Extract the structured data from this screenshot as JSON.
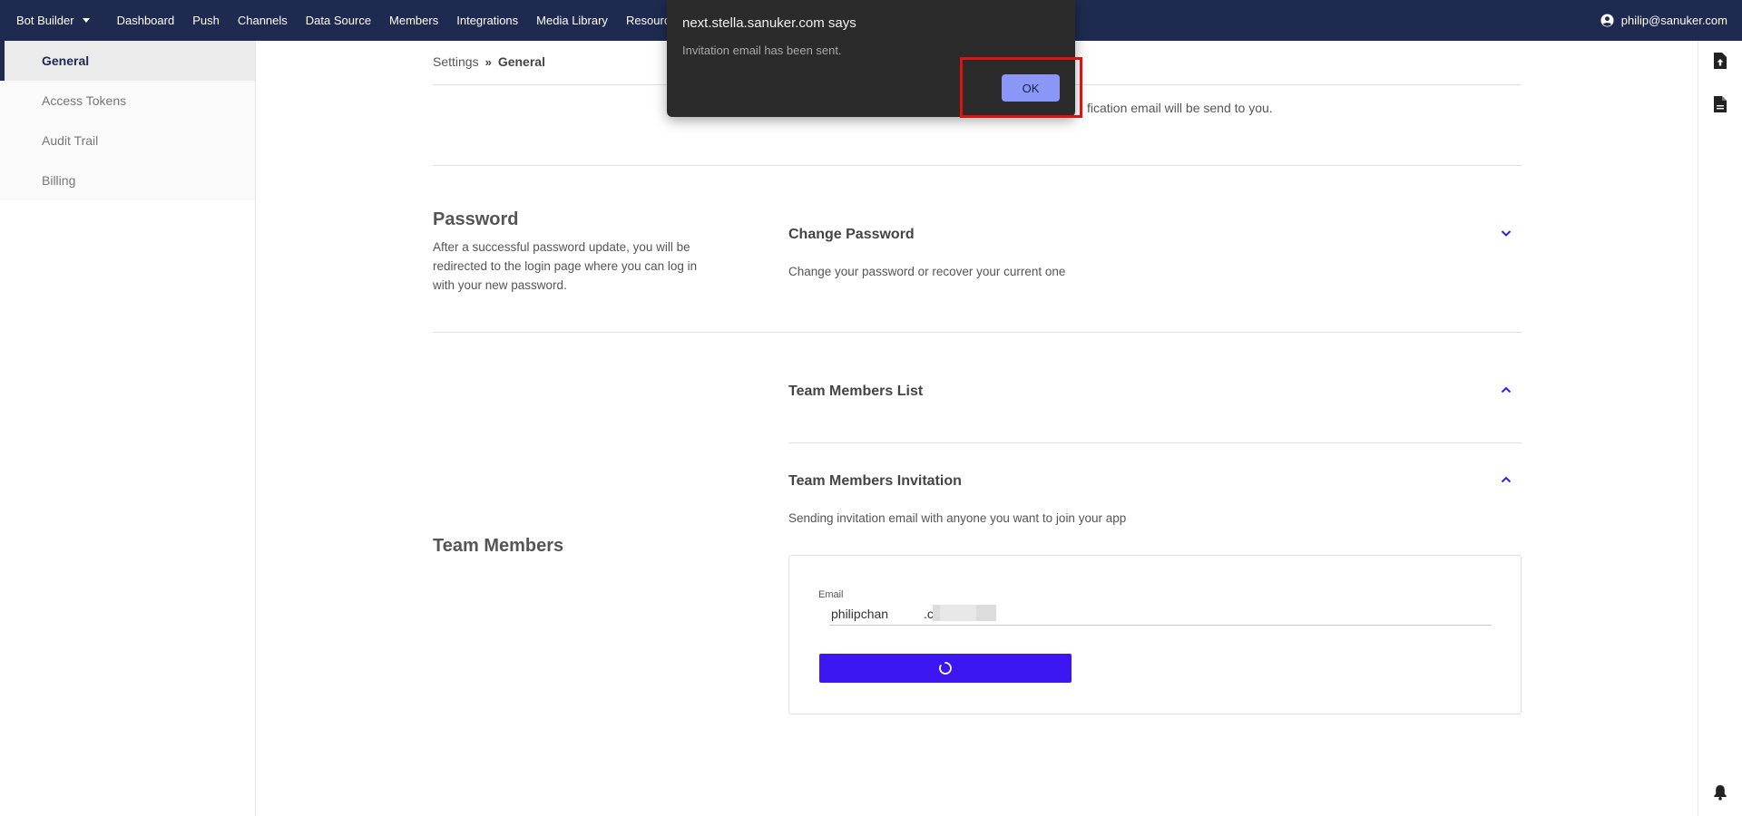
{
  "nav": {
    "brand": "Bot Builder",
    "items": [
      "Dashboard",
      "Push",
      "Channels",
      "Data Source",
      "Members",
      "Integrations",
      "Media Library",
      "Resources"
    ],
    "user_email": "philip@sanuker.com"
  },
  "sidebar": {
    "items": [
      {
        "label": "General",
        "active": true
      },
      {
        "label": "Access Tokens",
        "active": false
      },
      {
        "label": "Audit Trail",
        "active": false
      },
      {
        "label": "Billing",
        "active": false
      }
    ]
  },
  "breadcrumb": {
    "parent": "Settings",
    "separator": "»",
    "current": "General"
  },
  "email_section": {
    "partial_text": "fication email will be send to you."
  },
  "password_section": {
    "title": "Password",
    "description": "After a successful password update, you will be redirected to the login page where you can log in with your new password.",
    "panel_title": "Change Password",
    "panel_description": "Change your password or recover your current one"
  },
  "team_section": {
    "title": "Team Members",
    "list_title": "Team Members List",
    "invite_title": "Team Members Invitation",
    "invite_description": "Sending invitation email with anyone you want to join your app",
    "email_label": "Email",
    "email_value": "philipchan          .com",
    "send_state": "loading"
  },
  "dialog": {
    "title": "next.stella.sanuker.com says",
    "message": "Invitation email has been sent.",
    "ok_label": "OK"
  },
  "colors": {
    "nav_bg": "#1e2a4f",
    "accent": "#3d17f2",
    "dialog_bg": "#2b2b2b",
    "ok_button": "#8a97f6",
    "highlight": "#e01111"
  }
}
